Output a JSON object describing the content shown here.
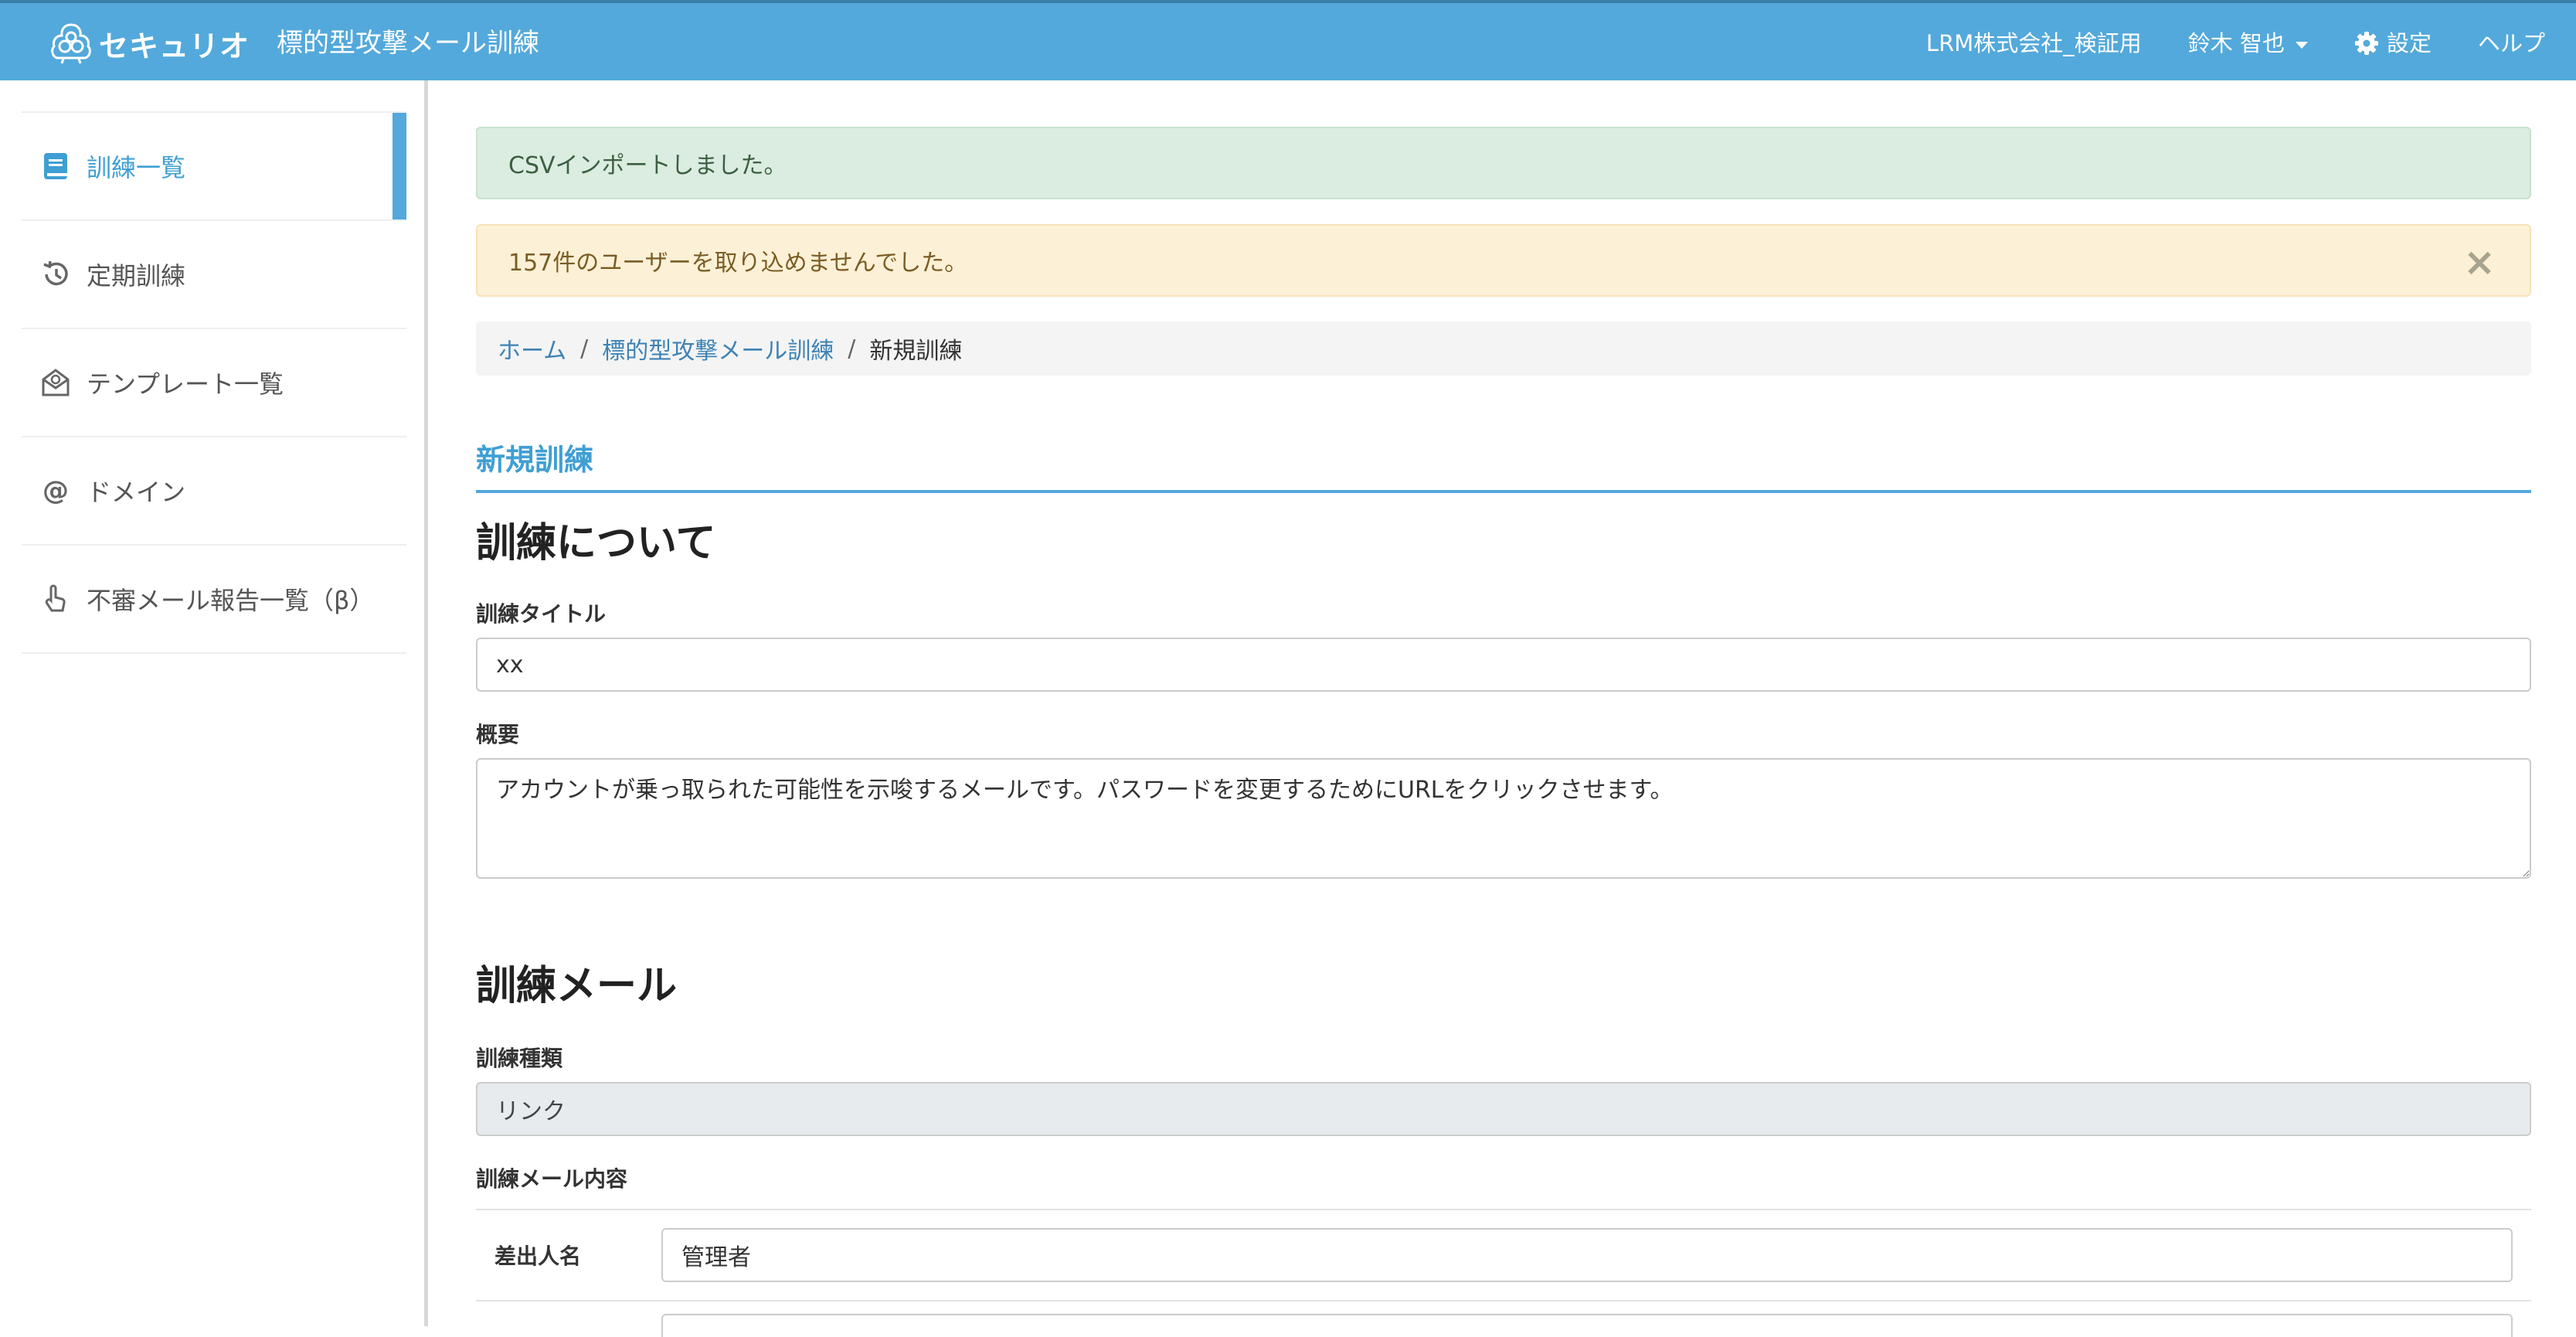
{
  "header": {
    "brand_name": "セキュリオ",
    "app_title": "標的型攻撃メール訓練",
    "company": "LRM株式会社_検証用",
    "user_name": "鈴木 智也",
    "settings_label": "設定",
    "help_label": "ヘルプ",
    "bar_color": "#53a9db"
  },
  "sidebar": {
    "items": [
      {
        "label": "訓練一覧",
        "icon": "book-icon",
        "active": true
      },
      {
        "label": "定期訓練",
        "icon": "history-icon",
        "active": false
      },
      {
        "label": "テンプレート一覧",
        "icon": "envelope-open-icon",
        "active": false
      },
      {
        "label": "ドメイン",
        "icon": "at-icon",
        "active": false
      },
      {
        "label": "不審メール報告一覧（β）",
        "icon": "hand-pointer-icon",
        "active": false
      }
    ]
  },
  "alerts": {
    "success_text": "CSVインポートしました。",
    "warning_text": "157件のユーザーを取り込めませんでした。",
    "close_glyph": "×"
  },
  "breadcrumb": {
    "home": "ホーム",
    "section": "標的型攻撃メール訓練",
    "current": "新規訓練",
    "separator": "/"
  },
  "page": {
    "heading": "新規訓練"
  },
  "about": {
    "title": "訓練について",
    "title_label": "訓練タイトル",
    "title_value": "xx",
    "summary_label": "概要",
    "summary_value": "アカウントが乗っ取られた可能性を示唆するメールです。パスワードを変更するためにURLをクリックさせます。"
  },
  "mail": {
    "title": "訓練メール",
    "type_label": "訓練種類",
    "type_value": "リンク",
    "content_label": "訓練メール内容",
    "sender_label": "差出人名",
    "sender_value": "管理者"
  }
}
